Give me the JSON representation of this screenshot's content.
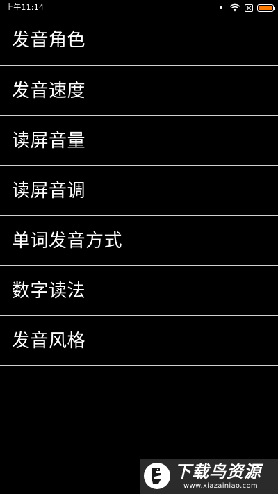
{
  "status_bar": {
    "time": "上午11:14",
    "icons": [
      "notification-dot-icon",
      "wifi-icon",
      "no-sim-icon",
      "battery-icon"
    ],
    "battery_level": 0.95,
    "battery_color": "#ff7a00"
  },
  "settings": {
    "items": [
      {
        "label": "发音角色"
      },
      {
        "label": "发音速度"
      },
      {
        "label": "读屏音量"
      },
      {
        "label": "读屏音调"
      },
      {
        "label": "单词发音方式"
      },
      {
        "label": "数字读法"
      },
      {
        "label": "发音风格"
      }
    ]
  },
  "watermark": {
    "title": "下载鸟资源",
    "url": "www.xiazainiao.com"
  },
  "colors": {
    "background": "#000000",
    "text": "#ffffff",
    "divider": "#d0d0d0",
    "watermark_bg": "#2b2b2b"
  }
}
